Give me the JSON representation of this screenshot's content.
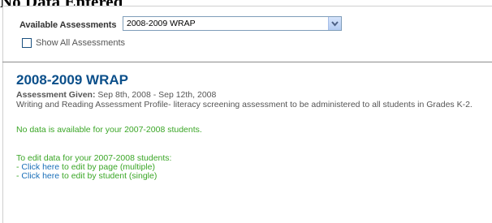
{
  "page": {
    "heading": "No Data Entered"
  },
  "selector": {
    "label": "Available Assessments",
    "selected": "2008-2009 WRAP",
    "show_all_label": "Show All Assessments"
  },
  "assessment": {
    "title": "2008-2009 WRAP",
    "given_label": "Assessment Given:",
    "given_dates": "Sep 8th, 2008 - Sep 12th, 2008",
    "description": "Writing and Reading Assessment Profile- literacy screening assessment to be administered to all students in Grades K-2."
  },
  "messages": {
    "no_data": "No data is available for your 2007-2008 students.",
    "edit_intro": "To edit data for your 2007-2008 students:",
    "page_prefix": "- ",
    "page_link": "Click here",
    "page_suffix": " to edit by page (multiple)",
    "student_prefix": "- ",
    "student_link": "Click here",
    "student_suffix": " to edit by student (single)"
  }
}
